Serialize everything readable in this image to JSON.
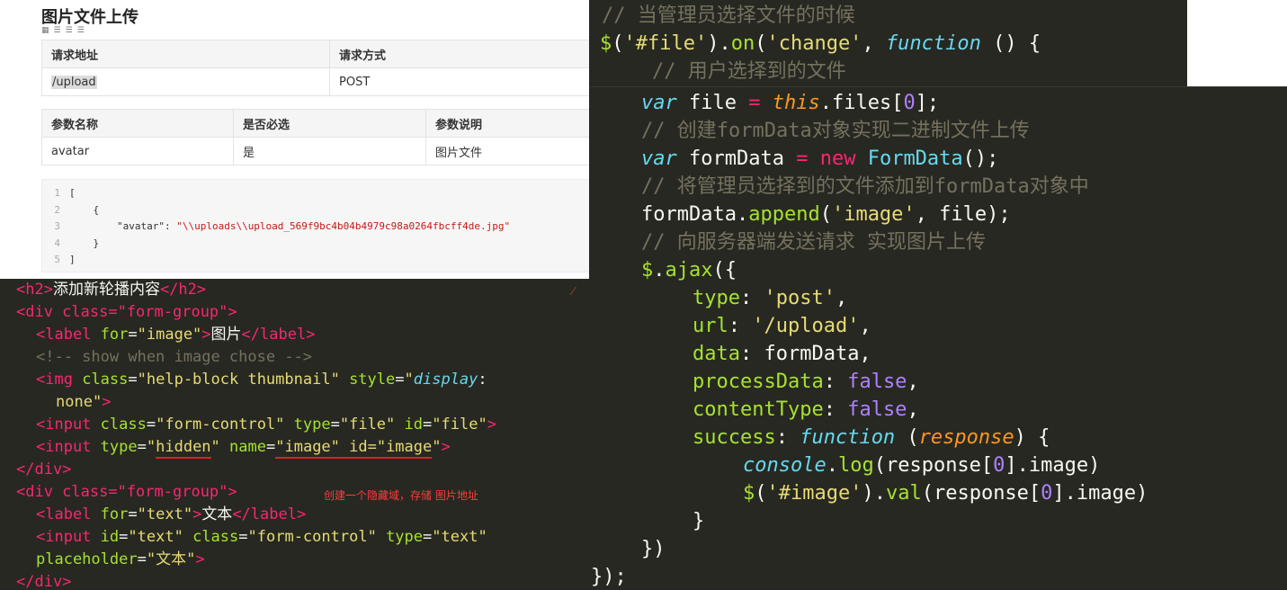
{
  "doc": {
    "title": "图片文件上传",
    "toolbar_icons": [
      "grid-icon",
      "align-left-icon",
      "align-center-icon",
      "align-right-icon"
    ],
    "table1": {
      "headers": [
        "请求地址",
        "请求方式"
      ],
      "row": [
        "/upload",
        "POST"
      ]
    },
    "table2": {
      "headers": [
        "参数名称",
        "是否必选",
        "参数说明"
      ],
      "row": [
        "avatar",
        "是",
        "图片文件"
      ]
    },
    "code_sample": {
      "lines": [
        "[",
        "    {",
        "        \"avatar\": ",
        "    }",
        "]"
      ],
      "line_numbers": [
        "1",
        "2",
        "3",
        "4",
        "5"
      ],
      "avatar_value": "\"\\\\uploads\\\\upload_569f9bc4b04b4979c98a0264fbcff4de.jpg\""
    }
  },
  "html_code": {
    "h2_open": "<h2>",
    "h2_text": "添加新轮播内容",
    "h2_close": "</h2>",
    "lines": {
      "div1": "<div class=\"form-group\">",
      "label_img": "图片",
      "comment": "<!-- show when image chose -->",
      "img_tag": "<img class=\"help-block thumbnail\" style=\"display:",
      "img_none": "none\">",
      "input_file": "<input class=\"form-control\" type=\"file\" id=\"file\">",
      "input_hidden_pre": "<input type=\"",
      "hidden": "hidden",
      "name_attr": "\" name=\"",
      "image_id": "image\" id=\"image",
      "close_div": "</div>",
      "div2": "<div class=\"form-group\">",
      "label_text": "文本",
      "input_text": "<input id=\"text\" class=\"form-control\" type=\"text\"",
      "placeholder": "placeholder=\"文本\">",
      "close_div2": "</div>"
    },
    "annotation": "创建一个隐藏域，存储 图片地址"
  },
  "js_code": {
    "comment1": "// 当管理员选择文件的时候",
    "line2": "$('#file').on('change', function () {",
    "comment2": "// 用户选择到的文件",
    "line4": "var file = this.files[0];",
    "comment3": "// 创建formData对象实现二进制文件上传",
    "line6": "var formData = new FormData();",
    "comment4": "// 将管理员选择到的文件添加到formData对象中",
    "line8": "formData.append('image', file);",
    "comment5": "// 向服务器端发送请求 实现图片上传",
    "line10": "$.ajax({",
    "type": "type: 'post',",
    "url": "url: '/upload',",
    "data": "data: formData,",
    "processData": "processData: false,",
    "contentType": "contentType: false,",
    "success": "success: function (response) {",
    "console": "console.log(response[0].image)",
    "val": "$('#image').val(response[0].image)",
    "close1": "}",
    "close2": "})",
    "close3": "});"
  },
  "colors": {
    "editor_bg": "#272822",
    "annotation_red": "#ff3b3b",
    "tag_pink": "#f92672",
    "attr_green": "#a6e22e",
    "string_yellow": "#e6db74",
    "comment_gray": "#75715e",
    "keyword_cyan": "#66d9ef",
    "number_purple": "#ae81ff",
    "orange": "#fd971f"
  }
}
